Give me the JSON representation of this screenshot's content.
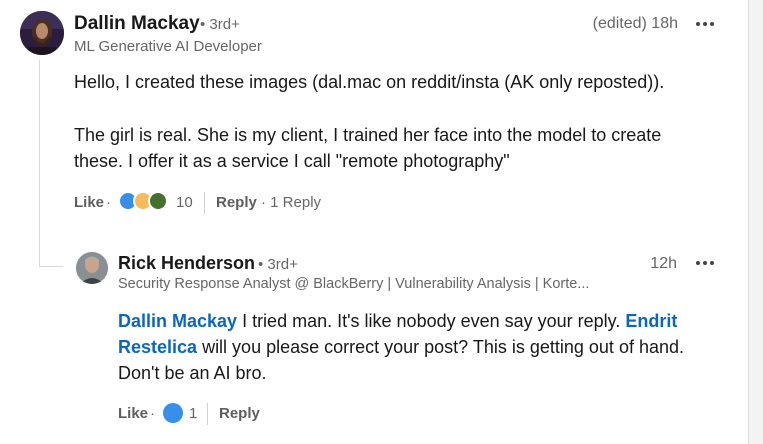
{
  "comment": {
    "author": "Dallin Mackay",
    "degree": "• 3rd+",
    "headline": "ML Generative AI Developer",
    "time": "(edited) 18h",
    "body_lines": [
      "Hello, I created these images (dal.mac on reddit/insta (AK only reposted)).",
      "The girl is real. She is my client, I trained her face into the model to create",
      "these. I offer it as a service I call \"remote photography\""
    ],
    "like_label": "Like",
    "dot": "·",
    "reaction_count": "10",
    "reply_label": "Reply",
    "replies_count": "· 1 Reply",
    "reactions": [
      "like-icon",
      "idea-icon",
      "support-icon"
    ]
  },
  "reply": {
    "author": "Rick Henderson",
    "degree": "• 3rd+",
    "headline": "Security Response Analyst @ BlackBerry | Vulnerability Analysis | Korte...",
    "time": "12h",
    "mention1": "Dallin Mackay",
    "text1": " I tried man. It's like nobody even say your reply. ",
    "mention2a": "Endrit",
    "mention2b": "Restelica",
    "text2": " will you please correct your post? This is getting out of hand.",
    "line3": "Don't be an AI bro.",
    "like_label": "Like",
    "dot": "·",
    "reaction_count": "1",
    "reply_label": "Reply"
  },
  "colors": {
    "link": "#0a66c2",
    "secondary_text": "#666666",
    "like_reaction": "#378fe9",
    "idea_reaction": "#f5bb5c",
    "support_reaction": "#44712e"
  }
}
